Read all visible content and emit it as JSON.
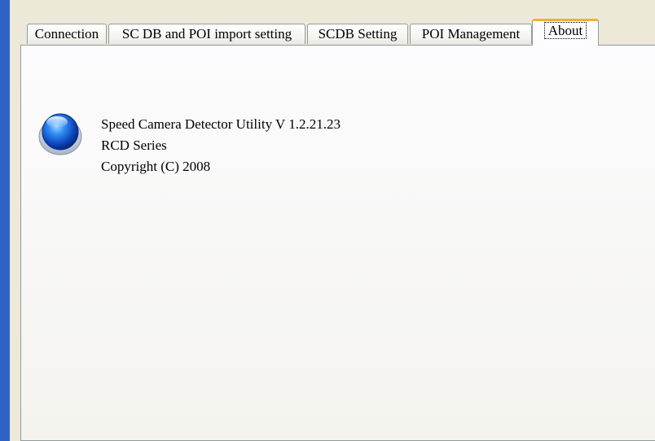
{
  "tabs": [
    {
      "label": "Connection"
    },
    {
      "label": "SC DB and POI import setting"
    },
    {
      "label": "SCDB  Setting"
    },
    {
      "label": "POI Management"
    },
    {
      "label": "About",
      "active": true
    }
  ],
  "about": {
    "icon": "blue-orb-icon",
    "product": "Speed Camera Detector Utility  V 1.2.21.23",
    "series": "RCD Series",
    "copyright": "Copyright (C) 2008"
  },
  "colors": {
    "active_tab_accent": "#f2b02c",
    "window_frame": "#2e62c6",
    "orb": "#1f6fe0"
  }
}
